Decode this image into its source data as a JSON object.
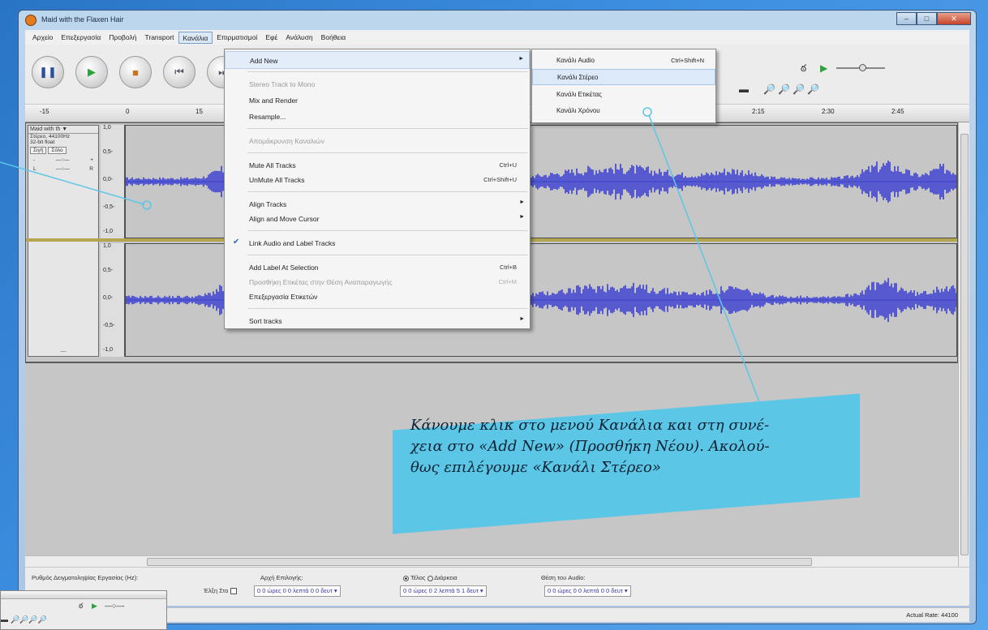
{
  "window": {
    "title": "Maid with the Flaxen Hair",
    "minimize": "–",
    "maximize": "□",
    "close": "✕"
  },
  "menubar": [
    "Αρχείο",
    "Επεξεργασία",
    "Προβολή",
    "Transport",
    "Κανάλια",
    "Επιρματισμοί",
    "Εφέ",
    "Ανάλυση",
    "Βοήθεια"
  ],
  "toolbar": {
    "pause_icon": "pause-icon",
    "play_icon": "play-icon",
    "stop_icon": "stop-icon",
    "skip_start_icon": "skip-to-start-icon",
    "skip_end_icon": "skip-to-end-icon"
  },
  "ruler": {
    "ticks": [
      "-15",
      "0",
      "15",
      "2:15",
      "2:30",
      "2:45"
    ]
  },
  "track": {
    "name": "Maid with th ▼",
    "rate": "Στέρεο, 44100Hz",
    "format": "32-bit float",
    "mute": "Σιγή",
    "solo": "Σόλο",
    "gain_minus": "-",
    "gain_plus": "+",
    "pan_left": "L",
    "pan_right": "R",
    "collapse": "—",
    "scale_top": [
      "1,0",
      "0,5-",
      "0,0-",
      "-0,5-",
      "-1,0"
    ],
    "scale_bottom": [
      "1,0",
      "0,5-",
      "0,0-",
      "-0,5-",
      "-1,0"
    ]
  },
  "menu": {
    "items": [
      {
        "label": "Add New",
        "shortcut": "",
        "arrow": "►",
        "disabled": false
      },
      {
        "label": "Stereo Track to Mono",
        "shortcut": "",
        "arrow": "",
        "disabled": true
      },
      {
        "label": "Mix and Render",
        "shortcut": "",
        "arrow": "",
        "disabled": false
      },
      {
        "label": "Resample...",
        "shortcut": "",
        "arrow": "",
        "disabled": false
      },
      {
        "label": "Απομάκρυνση Καναλιών",
        "shortcut": "",
        "arrow": "",
        "disabled": true
      },
      {
        "label": "Mute All Tracks",
        "shortcut": "Ctrl+U",
        "arrow": "",
        "disabled": false
      },
      {
        "label": "UnMute All Tracks",
        "shortcut": "Ctrl+Shift+U",
        "arrow": "",
        "disabled": false
      },
      {
        "label": "Align Tracks",
        "shortcut": "",
        "arrow": "►",
        "disabled": false
      },
      {
        "label": "Align and Move Cursor",
        "shortcut": "",
        "arrow": "►",
        "disabled": false
      },
      {
        "label": "Link Audio and Label Tracks",
        "shortcut": "",
        "arrow": "",
        "disabled": false,
        "checked": "✔"
      },
      {
        "label": "Add Label At Selection",
        "shortcut": "Ctrl+B",
        "arrow": "",
        "disabled": false
      },
      {
        "label": "Προσθήκη Ετικέτας στην Θέση Αναπαραγωγής",
        "shortcut": "Ctrl+M",
        "arrow": "",
        "disabled": true
      },
      {
        "label": "Επεξεργασία Ετικετών",
        "shortcut": "",
        "arrow": "",
        "disabled": false
      },
      {
        "label": "Sort tracks",
        "shortcut": "",
        "arrow": "►",
        "disabled": false
      }
    ]
  },
  "submenu": {
    "items": [
      {
        "label": "Κανάλι Audio",
        "shortcut": "Ctrl+Shift+N"
      },
      {
        "label": "Κανάλι Στέρεο",
        "shortcut": ""
      },
      {
        "label": "Κανάλι Ετικέτας",
        "shortcut": ""
      },
      {
        "label": "Κανάλι Χρόνου",
        "shortcut": ""
      }
    ]
  },
  "selection": {
    "rate_label": "Ρυθμός Δειγματοληψίας Εργασίας (Hz):",
    "start_label": "Αρχή Επιλογής:",
    "end_label": "Τέλος",
    "length_label": "Διάρκεια",
    "audio_pos_label": "Θέση του Audio:",
    "snap_label": "Έλξη Στο",
    "start_value": "0 0 ώρες 0 0 λεπτά 0 0 δευτ ▾",
    "end_value": "0 0 ώρες 0 2 λεπτά 5 1 δευτ ▾",
    "audio_value": "0 0 ώρες 0 0 λεπτά 0 0 δευτ ▾"
  },
  "status": {
    "actual_rate": "Actual Rate: 44100"
  },
  "callout": {
    "line1": "Κάνουμε κλικ στο μενού Κανάλια και στη συνέ-",
    "line2": "χεια στο «Add New» (Προσθήκη Νέου). Ακολού-",
    "line3": "θως επιλέγουμε «Κανάλι Στέρεο»"
  },
  "colors": {
    "waveform": "#3a3fd0",
    "callout": "#5cc6e7",
    "track_bg": "#c6c6c6"
  }
}
